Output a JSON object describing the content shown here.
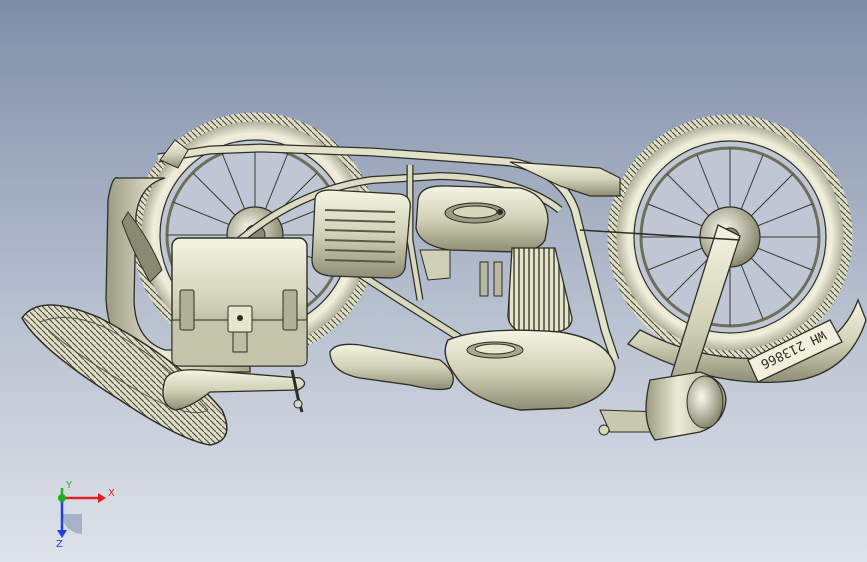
{
  "viewport": {
    "plate_text": "WH 213866"
  },
  "triad": {
    "x_label": "X",
    "y_label": "Y",
    "z_label": "Z",
    "x_color": "#e02020",
    "y_color": "#20b020",
    "z_color": "#2040e0"
  },
  "colors": {
    "metal_light": "#eeeed8",
    "metal_mid": "#c9c9b0",
    "metal_dark": "#7c7c66",
    "outline": "#2e2e26"
  }
}
